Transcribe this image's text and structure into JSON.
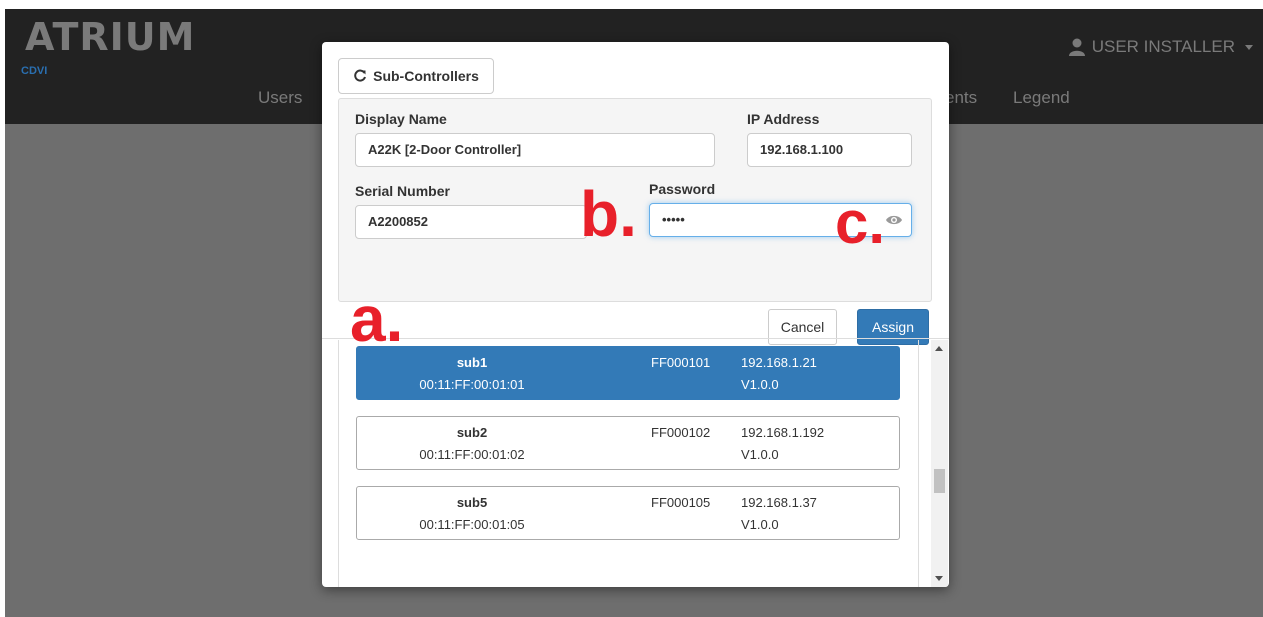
{
  "app": {
    "logo": "ATRIUM",
    "sublogo": "CDVI",
    "nav": [
      "Users",
      "ents",
      "Legend"
    ],
    "user_label": "USER INSTALLER"
  },
  "modal": {
    "header_button": "Sub-Controllers",
    "form": {
      "display_name_label": "Display Name",
      "display_name_value": "A22K [2-Door Controller]",
      "ip_label": "IP Address",
      "ip_value": "192.168.1.100",
      "serial_label": "Serial Number",
      "serial_value": "A2200852",
      "password_label": "Password",
      "password_value": "•••••",
      "cancel_label": "Cancel",
      "assign_label": "Assign"
    },
    "subcontrollers": [
      {
        "name": "sub1",
        "mac": "00:11:FF:00:01:01",
        "serial": "FF000101",
        "ip": "192.168.1.21",
        "version": "V1.0.0",
        "selected": true
      },
      {
        "name": "sub2",
        "mac": "00:11:FF:00:01:02",
        "serial": "FF000102",
        "ip": "192.168.1.192",
        "version": "V1.0.0",
        "selected": false
      },
      {
        "name": "sub5",
        "mac": "00:11:FF:00:01:05",
        "serial": "FF000105",
        "ip": "192.168.1.37",
        "version": "V1.0.0",
        "selected": false
      }
    ]
  },
  "annotations": {
    "a": "a.",
    "b": "b.",
    "c": "c."
  },
  "colors": {
    "primary": "#337ab7",
    "navbar": "#222222",
    "backdrop": "#6e6e6e",
    "annotation": "#e8202a"
  }
}
